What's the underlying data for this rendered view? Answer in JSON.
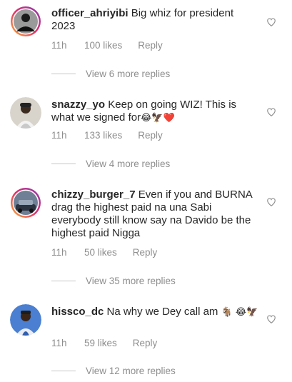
{
  "comments": [
    {
      "username": "officer_ahriyibi",
      "text": "Big whiz for president 2023",
      "time": "11h",
      "likes": "100 likes",
      "reply": "Reply",
      "more_replies": "View 6 more replies"
    },
    {
      "username": "snazzy_yo",
      "text": "Keep on going WIZ! This is what we signed for",
      "emojis": "😂🦅❤️",
      "time": "11h",
      "likes": "133 likes",
      "reply": "Reply",
      "more_replies": "View 4 more replies"
    },
    {
      "username": "chizzy_burger_7",
      "text": "Even if you and BURNA drag the highest paid na una Sabi everybody still know say na Davido be the highest paid Nigga",
      "time": "11h",
      "likes": "50 likes",
      "reply": "Reply",
      "more_replies": "View 35 more replies"
    },
    {
      "username": "hissco_dc",
      "text": "Na why we Dey call am",
      "emojis": "🐐 😂🦅",
      "time": "11h",
      "likes": "59 likes",
      "reply": "Reply",
      "more_replies": "View 12 more replies"
    }
  ],
  "colors": {
    "text": "#262626",
    "meta": "#8e8e8e",
    "heart_stroke": "#8e8e8e"
  }
}
